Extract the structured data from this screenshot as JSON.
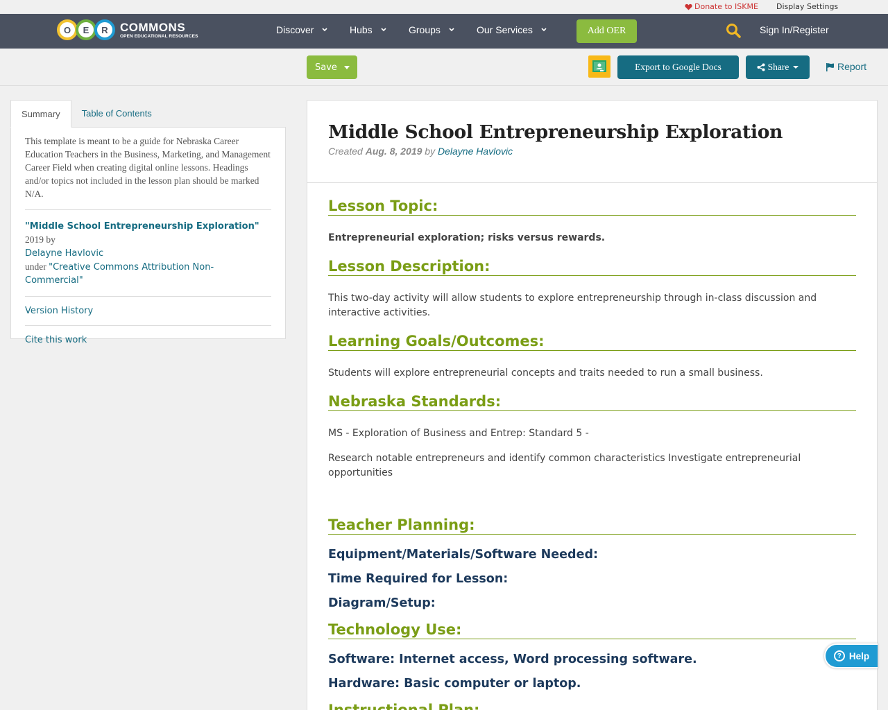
{
  "utility": {
    "donate_label": "Donate to ISKME",
    "display_settings_label": "Display Settings"
  },
  "nav": {
    "logo_letters": [
      "O",
      "E",
      "R"
    ],
    "logo_word": "COMMONS",
    "logo_sub": "OPEN EDUCATIONAL RESOURCES",
    "items": [
      {
        "label": "Discover"
      },
      {
        "label": "Hubs"
      },
      {
        "label": "Groups"
      },
      {
        "label": "Our Services"
      }
    ],
    "add_oer_label": "Add OER",
    "sign_in_label": "Sign In/Register"
  },
  "toolbar": {
    "save_label": "Save",
    "export_label": "Export to Google Docs",
    "share_label": "Share",
    "report_label": "Report"
  },
  "sidebar": {
    "tabs": [
      {
        "label": "Summary"
      },
      {
        "label": "Table of Contents"
      }
    ],
    "summary": "This template is meant to be a guide for Nebraska Career Education Teachers in the Business, Marketing, and Management Career Field when creating digital online lessons. Headings and/or topics not included in the lesson plan should be marked N/A.",
    "attribution": {
      "title": "\"Middle School Entrepreneurship Exploration\"",
      "year_by": " 2019 by",
      "author": "Delayne Havlovic",
      "under": "under ",
      "license": "\"Creative Commons Attribution Non-Commercial\""
    },
    "version_history_label": "Version History",
    "cite_label": "Cite this work"
  },
  "main": {
    "title": "Middle School Entrepreneurship Exploration",
    "created_label": "Created",
    "date": "Aug. 8, 2019",
    "by_label": "by",
    "author": "Delayne Havlovic",
    "sections": {
      "topic_heading": "Lesson Topic:",
      "topic_text": "Entrepreneurial exploration; risks versus rewards.",
      "description_heading": "Lesson Description:",
      "description_text": "This two-day activity will allow students to explore entrepreneurship through in-class discussion and interactive activities.",
      "goals_heading": "Learning Goals/Outcomes:",
      "goals_text": "Students will explore entrepreneurial concepts and traits needed to run a small business.",
      "standards_heading": "Nebraska Standards:",
      "standards_text1": "MS - Exploration of Business and Entrep: Standard 5 -",
      "standards_text2": "Research notable entrepreneurs and identify common characteristics Investigate entrepreneurial opportunities",
      "planning_heading": "Teacher Planning:",
      "equipment_label": "Equipment/Materials/Software Needed:",
      "time_label": "Time Required for Lesson:",
      "diagram_label": "Diagram/Setup:",
      "technology_heading": "Technology Use:",
      "software_text": "Software: Internet access, Word processing software.",
      "hardware_text": "Hardware: Basic computer or laptop.",
      "next_heading": "Instructional Plan:"
    }
  },
  "help": {
    "label": "Help"
  },
  "colors": {
    "nav_bg": "#4a5160",
    "green": "#8bbb3f",
    "teal": "#166c82",
    "heading_green": "#7a9d15",
    "help_blue": "#1f9bd3"
  }
}
